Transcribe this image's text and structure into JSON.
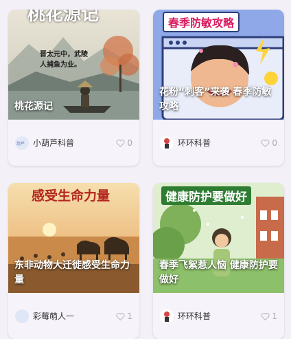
{
  "cards": [
    {
      "banner": "桃花源记",
      "poem": "晋太元中，武陵人捕鱼为业。",
      "title": "桃花源记",
      "author": "小葫芦科普",
      "likes": "0"
    },
    {
      "banner": "春季防敏攻略",
      "title": "花粉“刺客”来袭 春季防敏攻略",
      "author": "环环科普",
      "likes": "0"
    },
    {
      "banner": "感受生命力量",
      "title": "东非动物大迁徙感受生命力量",
      "author": "彩莓萌人一",
      "likes": "1"
    },
    {
      "banner": "健康防护要做好",
      "title": "春季飞絮惹人恼 健康防护要做好",
      "author": "环环科普",
      "likes": "1"
    }
  ],
  "colors": {
    "background": "#f3f1f7",
    "card": "#f7f3fb",
    "banner_green": "#2e7d32",
    "banner_pink": "#d81b60",
    "banner_red": "#b3261e"
  }
}
